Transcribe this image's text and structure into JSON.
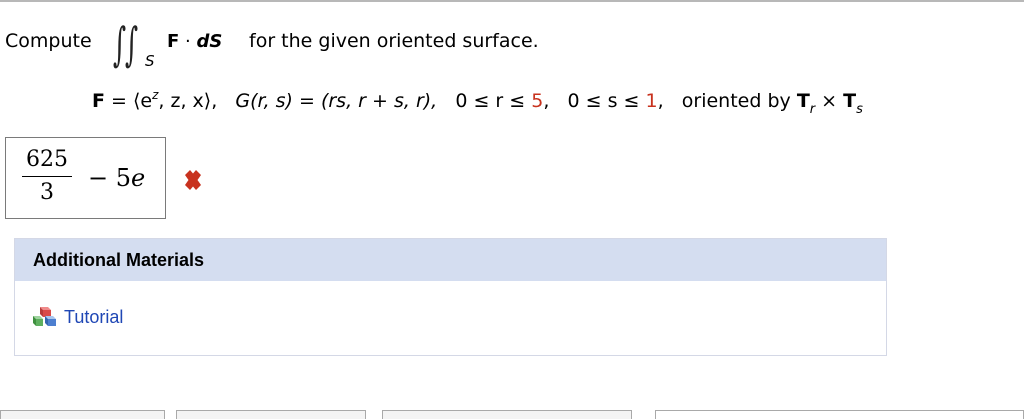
{
  "question": {
    "compute_label": "Compute",
    "integral_subscript": "S",
    "integrand_F": "F",
    "integrand_dot": " · ",
    "integrand_dS": "dS",
    "rest": "for the given oriented surface."
  },
  "equation": {
    "F_label": "F",
    "F_def_prefix": " = ⟨e",
    "F_sup": "z",
    "F_def_suffix": ", z, x⟩,",
    "G_def": "G(r, s) = (rs, r + s, r),",
    "r_range_prefix": "0 ≤ r ≤ ",
    "r_max": "5",
    "r_sep": ",",
    "s_range_prefix": "0 ≤ s ≤ ",
    "s_max": "1",
    "s_sep": ",",
    "oriented_text": "oriented by ",
    "T1": "T",
    "T1_sub": "r",
    "cross": " × ",
    "T2": "T",
    "T2_sub": "s"
  },
  "answer": {
    "numerator": "625",
    "denominator": "3",
    "minus": "−",
    "coef": "5",
    "var": "e",
    "status": "incorrect"
  },
  "additional_materials": {
    "heading": "Additional Materials",
    "tutorial_label": "Tutorial"
  },
  "colors": {
    "accent_red": "#c8321e",
    "link_blue": "#1f47b5",
    "header_bg": "#d4ddf0"
  }
}
